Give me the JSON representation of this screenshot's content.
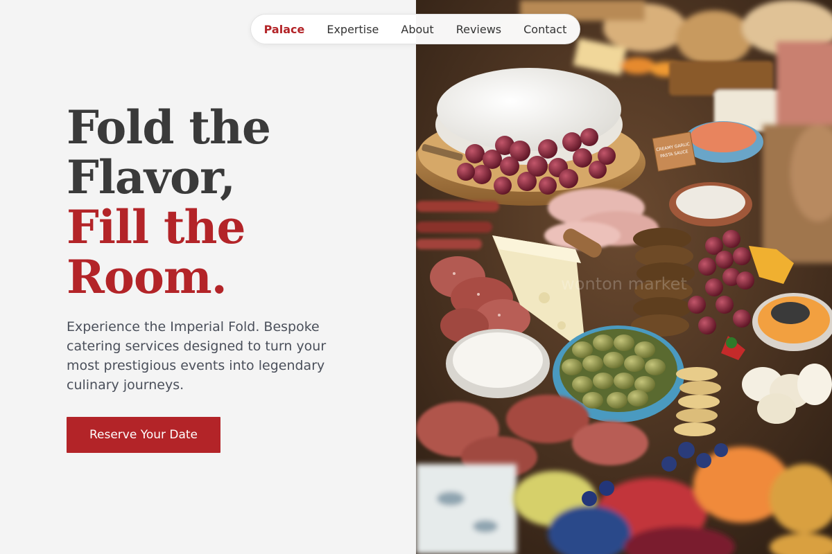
{
  "nav": {
    "items": [
      {
        "label": "Palace",
        "active": true
      },
      {
        "label": "Expertise",
        "active": false
      },
      {
        "label": "About",
        "active": false
      },
      {
        "label": "Reviews",
        "active": false
      },
      {
        "label": "Contact",
        "active": false
      }
    ]
  },
  "hero": {
    "headline_lines": [
      "Fold the",
      "Flavor,",
      "Fill the",
      "Room."
    ],
    "subtext": "Experience the Imperial Fold. Bespoke catering services designed to turn your most prestigious events into legendary culinary journeys.",
    "cta_label": "Reserve Your Date"
  },
  "image": {
    "sign_text": "CREAMY GARLIC PASTA SAUCE",
    "watermark": "wonton market"
  },
  "colors": {
    "accent": "#b32428",
    "heading": "#3a3a3a",
    "body": "#4a4f5a",
    "background": "#f4f4f4"
  }
}
